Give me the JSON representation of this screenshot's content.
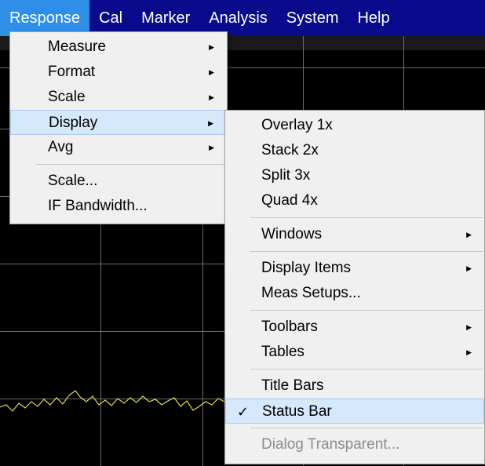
{
  "menubar": {
    "items": [
      {
        "label": "Response",
        "active": true
      },
      {
        "label": "Cal"
      },
      {
        "label": "Marker"
      },
      {
        "label": "Analysis"
      },
      {
        "label": "System"
      },
      {
        "label": "Help"
      }
    ]
  },
  "response_menu": {
    "items": [
      {
        "label": "Measure",
        "submenu": true
      },
      {
        "label": "Format",
        "submenu": true
      },
      {
        "label": "Scale",
        "submenu": true
      },
      {
        "label": "Display",
        "submenu": true,
        "highlighted": true
      },
      {
        "label": "Avg",
        "submenu": true
      },
      {
        "label": "Scale..."
      },
      {
        "label": "IF Bandwidth..."
      }
    ]
  },
  "display_menu": {
    "items": [
      {
        "label": "Overlay 1x"
      },
      {
        "label": "Stack 2x"
      },
      {
        "label": "Split 3x"
      },
      {
        "label": "Quad 4x"
      },
      {
        "label": "Windows",
        "submenu": true
      },
      {
        "label": "Display Items",
        "submenu": true
      },
      {
        "label": "Meas Setups..."
      },
      {
        "label": "Toolbars",
        "submenu": true
      },
      {
        "label": "Tables",
        "submenu": true
      },
      {
        "label": "Title Bars"
      },
      {
        "label": "Status Bar",
        "checked": true,
        "highlighted": true,
        "check_glyph": "✓"
      },
      {
        "label": "Dialog Transparent...",
        "disabled": true
      }
    ]
  },
  "icons": {
    "submenu_arrow": "submenu-arrow-icon",
    "check": "check-icon"
  },
  "colors": {
    "menubar_bg": "#0a0a8c",
    "menubar_active": "#2f8fe8",
    "menu_bg": "#f0f0f0",
    "highlight": "#d6e8fb",
    "trace": "#e0d84a",
    "grid": "#6e6e6e"
  }
}
